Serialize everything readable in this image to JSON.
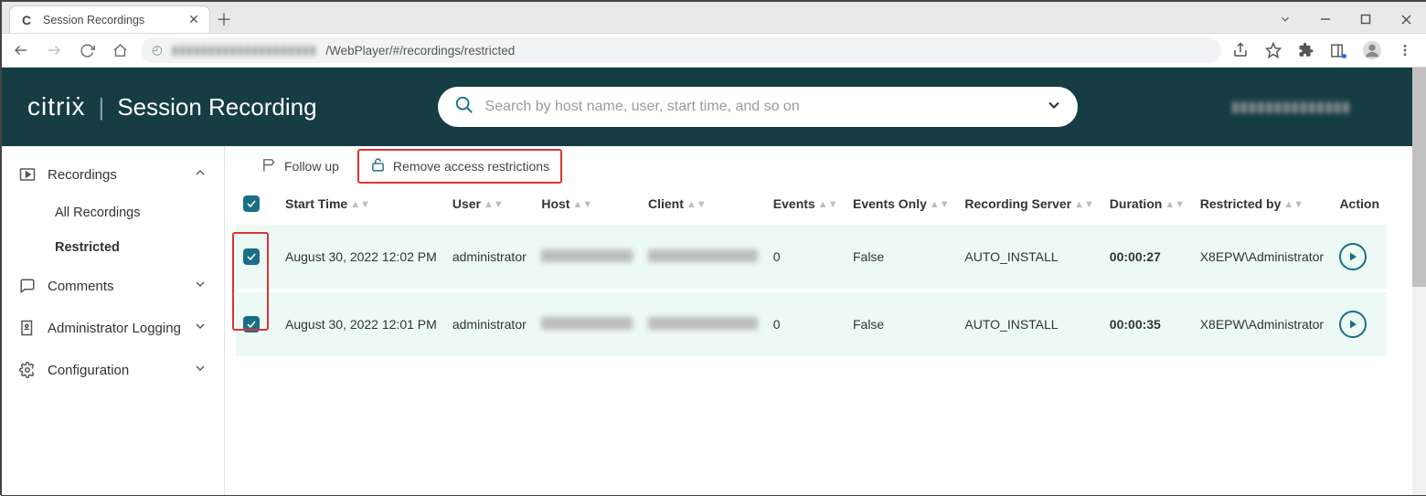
{
  "browser": {
    "tab_title": "Session Recordings",
    "url_visible": "/WebPlayer/#/recordings/restricted"
  },
  "app": {
    "brand_logo": "citriẋ",
    "brand_title": "Session Recording",
    "search_placeholder": "Search by host name, user, start time, and so on"
  },
  "sidebar": {
    "recordings": {
      "label": "Recordings",
      "sub_all": "All Recordings",
      "sub_restricted": "Restricted"
    },
    "comments": {
      "label": "Comments"
    },
    "admin_log": {
      "label": "Administrator Logging"
    },
    "config": {
      "label": "Configuration"
    }
  },
  "toolbar": {
    "follow_up": "Follow up",
    "remove_restrictions": "Remove access restrictions"
  },
  "table": {
    "headers": {
      "start_time": "Start Time",
      "user": "User",
      "host": "Host",
      "client": "Client",
      "events": "Events",
      "events_only": "Events Only",
      "rec_server": "Recording Server",
      "duration": "Duration",
      "restricted_by": "Restricted by",
      "action": "Action"
    },
    "rows": [
      {
        "start_time": "August 30, 2022 12:02 PM",
        "user": "administrator",
        "events": "0",
        "events_only": "False",
        "rec_server": "AUTO_INSTALL",
        "duration": "00:00:27",
        "restricted_by": "X8EPW\\Administrator"
      },
      {
        "start_time": "August 30, 2022 12:01 PM",
        "user": "administrator",
        "events": "0",
        "events_only": "False",
        "rec_server": "AUTO_INSTALL",
        "duration": "00:00:35",
        "restricted_by": "X8EPW\\Administrator"
      }
    ]
  }
}
